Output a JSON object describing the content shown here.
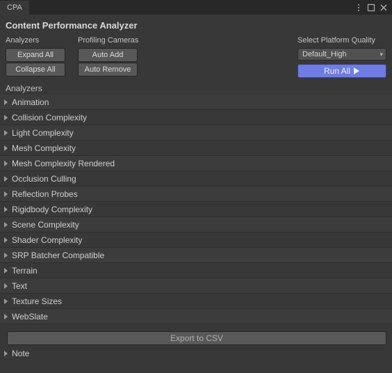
{
  "window": {
    "tab_title": "CPA"
  },
  "header": {
    "title": "Content Performance Analyzer"
  },
  "columns": {
    "analyzers_label": "Analyzers",
    "cameras_label": "Profiling Cameras",
    "platform_label": "Select Platform Quality"
  },
  "buttons": {
    "expand_all": "Expand All",
    "collapse_all": "Collapse All",
    "auto_add": "Auto Add",
    "auto_remove": "Auto Remove",
    "run_all": "Run All",
    "export_csv": "Export to CSV"
  },
  "platform": {
    "selected": "Default_High"
  },
  "list_header": "Analyzers",
  "analyzers": [
    {
      "label": "Animation"
    },
    {
      "label": "Collision Complexity"
    },
    {
      "label": "Light Complexity"
    },
    {
      "label": "Mesh Complexity"
    },
    {
      "label": "Mesh Complexity Rendered"
    },
    {
      "label": "Occlusion Culling"
    },
    {
      "label": "Reflection Probes"
    },
    {
      "label": "Rigidbody Complexity"
    },
    {
      "label": "Scene Complexity"
    },
    {
      "label": "Shader Complexity"
    },
    {
      "label": "SRP Batcher Compatible"
    },
    {
      "label": "Terrain"
    },
    {
      "label": "Text"
    },
    {
      "label": "Texture Sizes"
    },
    {
      "label": "WebSlate"
    }
  ],
  "note": {
    "label": "Note"
  }
}
